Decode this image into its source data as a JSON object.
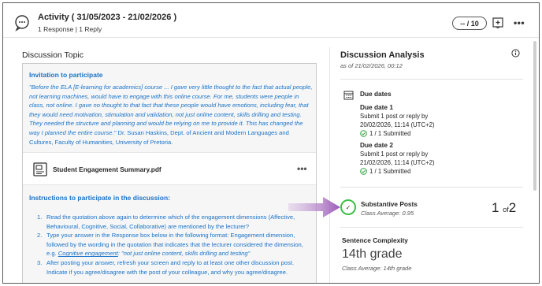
{
  "header": {
    "title": "Activity ( 31/05/2023 - 21/02/2026 )",
    "subtitle": "1 Response | 1 Reply",
    "grade": "-- / 10",
    "icons": {
      "activity": "discussion-bubble-icon",
      "add_grade": "add-grade-icon",
      "more": "more-options-icon"
    }
  },
  "topic": {
    "heading": "Discussion Topic",
    "invitation_title": "Invitation to participate",
    "quote": "\"Before the ELA [E-learning for academics] course ... I gave very little thought to the fact that actual people, not learning machines, would have to engage with this online course. For me, students were people in class, not online. I gave no thought to that fact that these people would have emotions, including fear, that they would need motivation, stimulation and validation, not just online content, skills drilling and testing. They needed the structure and planning and would be relying on me to provide it. This has changed the way I planned the entire course.\"",
    "attribution": " Dr. Susan Haskins, Dept. of Ancient and Modern Languages and Cultures, Faculty of Humanities, University of Pretoria.",
    "file": {
      "name": "Student Engagement Summary.pdf",
      "more": "•••"
    },
    "instructions_title": "Instructions to participate in the discussion:",
    "instructions": [
      {
        "num": "1.",
        "text": "Read the quotation above again to determine which of the engagement dimensions (Affective, Behavioural, Cognitive, Social, Collaborative) are mentioned by the lecturer?"
      },
      {
        "num": "2.",
        "text": "Type your answer in the Response box below in the following format: Engagement dimension, followed by the wording in the quotation that indicates that the lecturer considered the dimension, e.g.",
        "example_term": "Cognitive engagement",
        "example_rest": ": \"not just online content, skills drilling and testing\""
      },
      {
        "num": "3.",
        "text": "After posting your answer, refresh your screen and reply to at least one other discussion post. Indicate if you agree/disagree with the post of your colleague, and why you agree/disagree."
      }
    ]
  },
  "analysis": {
    "title": "Discussion Analysis",
    "as_of": "as of 21/02/2026, 00:12",
    "due_dates": {
      "heading": "Due dates",
      "items": [
        {
          "title": "Due date 1",
          "line1": "Submit 1 post or reply by",
          "line2": "20/02/2026, 11:14 (UTC+2)",
          "submitted": "1 / 1 Submitted"
        },
        {
          "title": "Due date 2",
          "line1": "Submit 1 post or reply by",
          "line2": "21/02/2026, 11:14 (UTC+2)",
          "submitted": "1 / 1 Submitted"
        }
      ]
    },
    "substantive": {
      "heading": "Substantive Posts",
      "avg": "Class Average: 0.95",
      "score": "1",
      "of": "of",
      "total": "2",
      "check": "✓"
    },
    "complexity": {
      "heading": "Sentence Complexity",
      "value": "14th grade",
      "avg": "Class Average: 14th grade"
    }
  },
  "colors": {
    "link_blue": "#1a73c9",
    "success_green": "#3ec04a",
    "arrow_purple": "#9b59b6"
  }
}
